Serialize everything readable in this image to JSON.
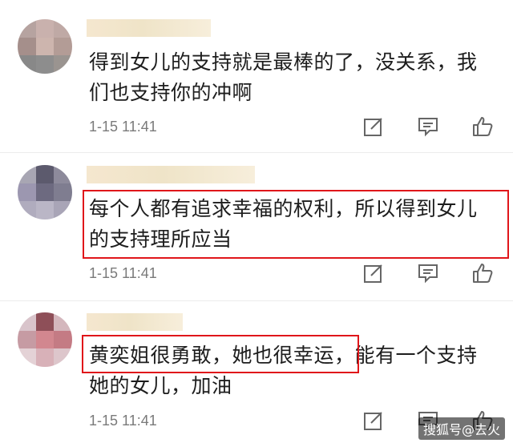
{
  "comments": [
    {
      "lines": [
        "得到女儿的支持就是最棒的了，没关系，我",
        "们也支持你的冲啊"
      ],
      "time": "1-15 11:41",
      "actions": [
        "edit-icon",
        "comment-icon",
        "like-icon"
      ]
    },
    {
      "lines": [
        "每个人都有追求幸福的权利，所以得到女儿",
        "的支持理所应当"
      ],
      "time": "1-15 11:41",
      "actions": [
        "edit-icon",
        "comment-icon",
        "like-icon"
      ]
    },
    {
      "lines": [
        "黄奕姐很勇敢，她也很幸运，能有一个支持",
        "她的女儿，加油"
      ],
      "time": "1-15 11:41",
      "actions": [
        "edit-icon",
        "comment-icon",
        "like-icon"
      ]
    }
  ],
  "highlight_color": "#e0161a",
  "watermark": "搜狐号@去火"
}
